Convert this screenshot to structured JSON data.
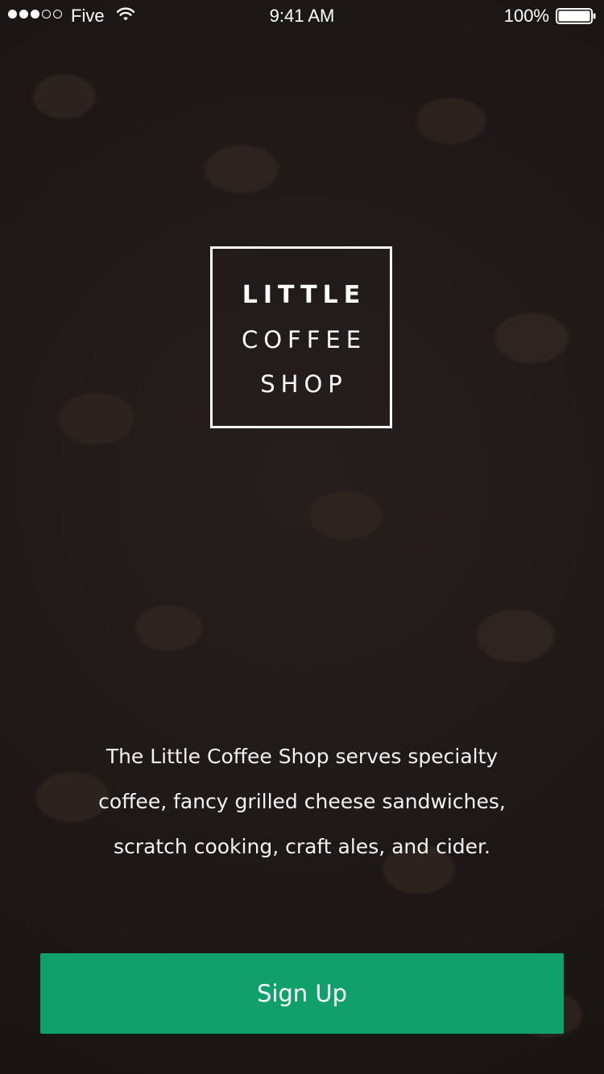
{
  "status_bar": {
    "carrier": "Five",
    "time": "9:41 AM",
    "battery": "100%",
    "signal_bars_filled": 3,
    "signal_bars_total": 5,
    "icons": {
      "wifi": "wifi-icon",
      "battery": "battery-icon"
    }
  },
  "logo": {
    "line1": "LITTLE",
    "line2": "COFFEE",
    "line3": "SHOP"
  },
  "description": {
    "line1": "The Little Coffee Shop serves specialty",
    "line2": "coffee, fancy grilled cheese sandwiches,",
    "line3": "scratch cooking, craft ales, and cider."
  },
  "signup_button": {
    "label": "Sign Up",
    "color": "#10a06a"
  },
  "colors": {
    "background": "#211c1b",
    "text": "#ffffff",
    "accent": "#10a06a"
  }
}
